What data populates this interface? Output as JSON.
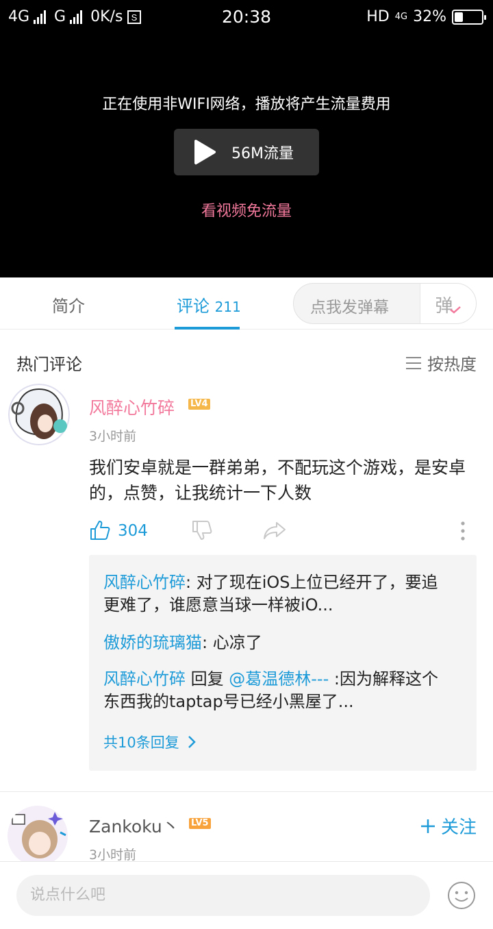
{
  "status_bar": {
    "net1": "4G",
    "net2": "G",
    "speed": "0K/s",
    "time": "20:38",
    "hd": "HD",
    "net3": "4G",
    "battery": "32%",
    "battery_level": 0.32
  },
  "video": {
    "warning": "正在使用非WIFI网络，播放将产生流量费用",
    "play_label": "56M流量",
    "free_link": "看视频免流量"
  },
  "tabs": {
    "intro": "简介",
    "comments": "评论",
    "comments_count": "211",
    "danmaku_placeholder": "点我发弹幕",
    "danmaku_button": "弹"
  },
  "hot": {
    "title": "热门评论",
    "sort": "按热度"
  },
  "comment1": {
    "user": "风醉心竹碎",
    "level": "LV4",
    "time": "3小时前",
    "text": "我们安卓就是一群弟弟，不配玩这个游戏，是安卓的，点赞，让我统计一下人数",
    "likes": "304",
    "replies": [
      {
        "name": "风醉心竹碎",
        "sep": ": ",
        "text": "对了现在iOS上位已经开了，要追更难了，谁愿意当球一样被iO..."
      },
      {
        "name": "傲娇的琉璃猫",
        "sep": ": ",
        "text": "心凉了"
      },
      {
        "name": "风醉心竹碎",
        "mid": " 回复 ",
        "target": "@葛温德林---",
        "text": " :因为解释这个东西我的taptap号已经小黑屋了..."
      }
    ],
    "more": "共10条回复"
  },
  "comment2": {
    "user": "Zankoku丶",
    "level": "LV5",
    "time": "3小时前",
    "follow": "关注"
  },
  "input": {
    "placeholder": "说点什么吧"
  },
  "colors": {
    "accent": "#1d9bd8",
    "pink": "#f2799c",
    "level": "#f6b74a"
  }
}
